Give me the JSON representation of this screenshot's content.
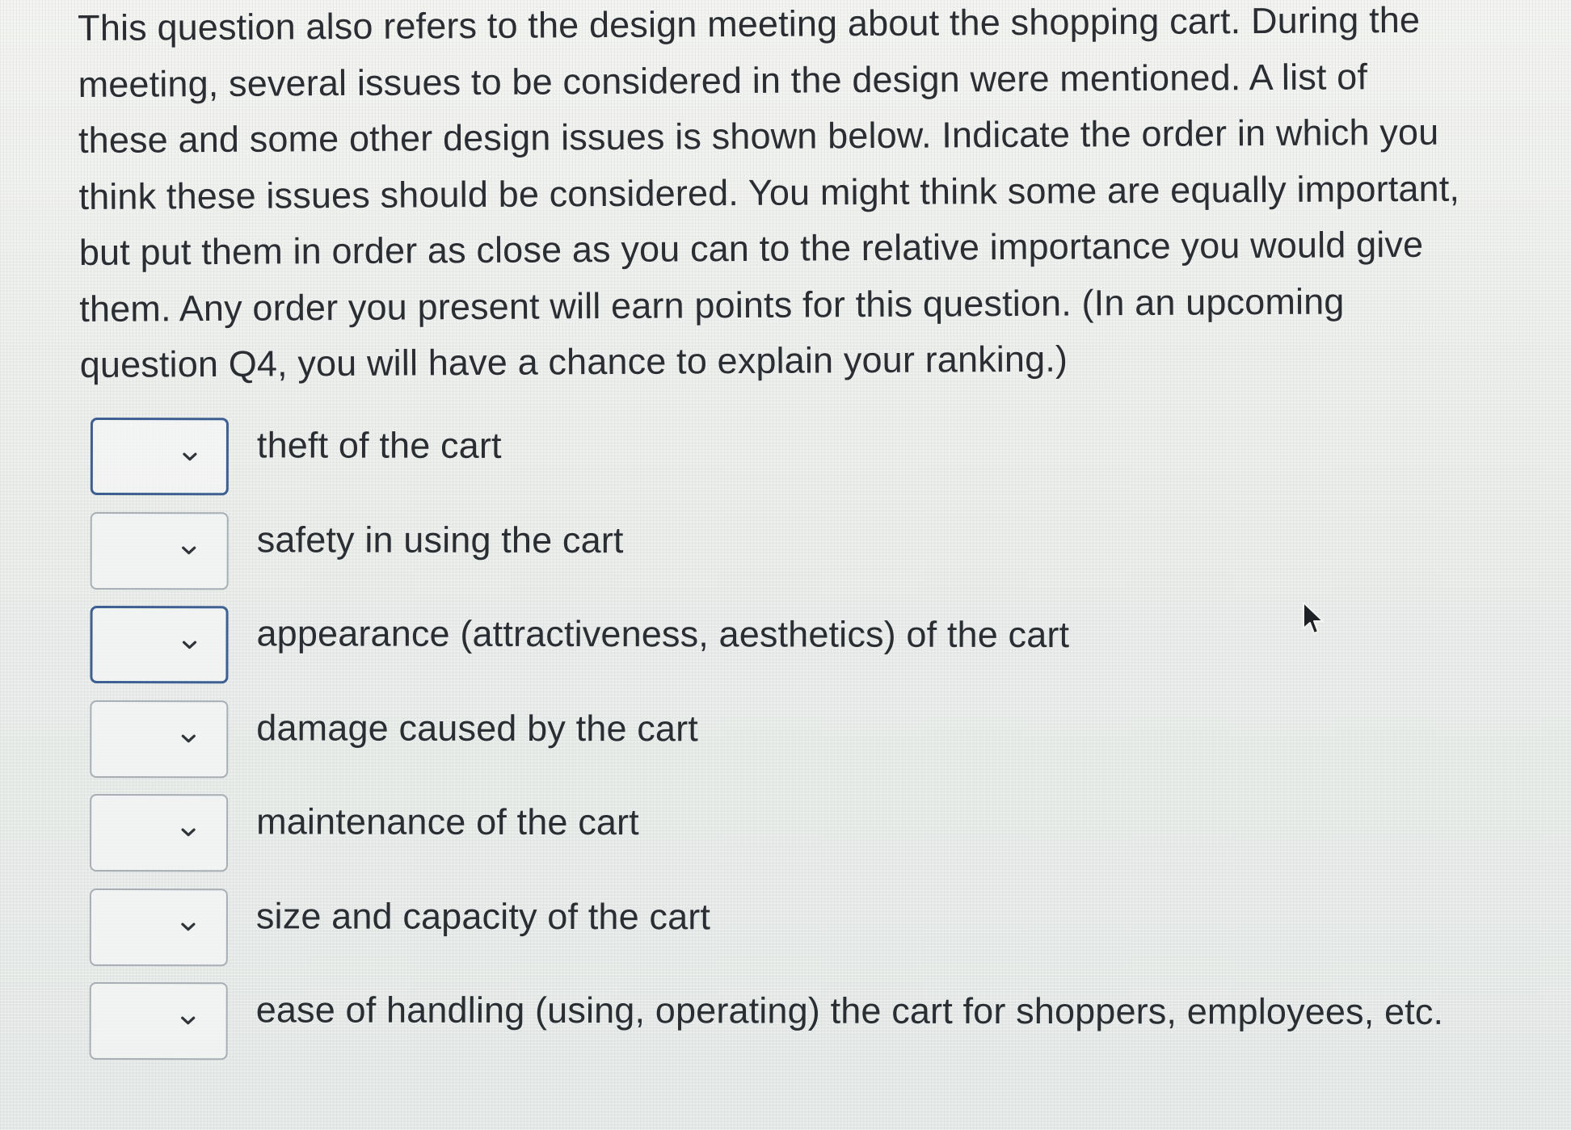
{
  "question": {
    "lines": [
      "This question also refers to the design meeting about the shopping cart. During the",
      "meeting, several issues to be considered in the design were mentioned.  A list of",
      "these and some other design issues is shown below.  Indicate the order in which you",
      "think these issues should be considered. You might think some are equally important,",
      "but put them in order as close as you can to the relative importance you would give",
      "them. Any order you present will earn points for this question. (In an upcoming",
      "question Q4, you will have a chance to explain your ranking.)"
    ]
  },
  "ranking": {
    "items": [
      {
        "label": "theft of the cart",
        "selected_value": ""
      },
      {
        "label": "safety in using the cart",
        "selected_value": ""
      },
      {
        "label": "appearance (attractiveness, aesthetics) of the cart",
        "selected_value": ""
      },
      {
        "label": "damage caused by the cart",
        "selected_value": ""
      },
      {
        "label": "maintenance of the cart",
        "selected_value": ""
      },
      {
        "label": "size and capacity of the cart",
        "selected_value": ""
      },
      {
        "label": "ease of handling (using, operating) the cart for shoppers, employees, etc.",
        "selected_value": ""
      }
    ],
    "dropdown_icon": "chevron-down-icon"
  },
  "colors": {
    "text": "#2a2e33",
    "select_border": "#a7aeb4",
    "select_border_focused": "#3d5f92"
  },
  "cursor_icon": "mouse-pointer-icon"
}
